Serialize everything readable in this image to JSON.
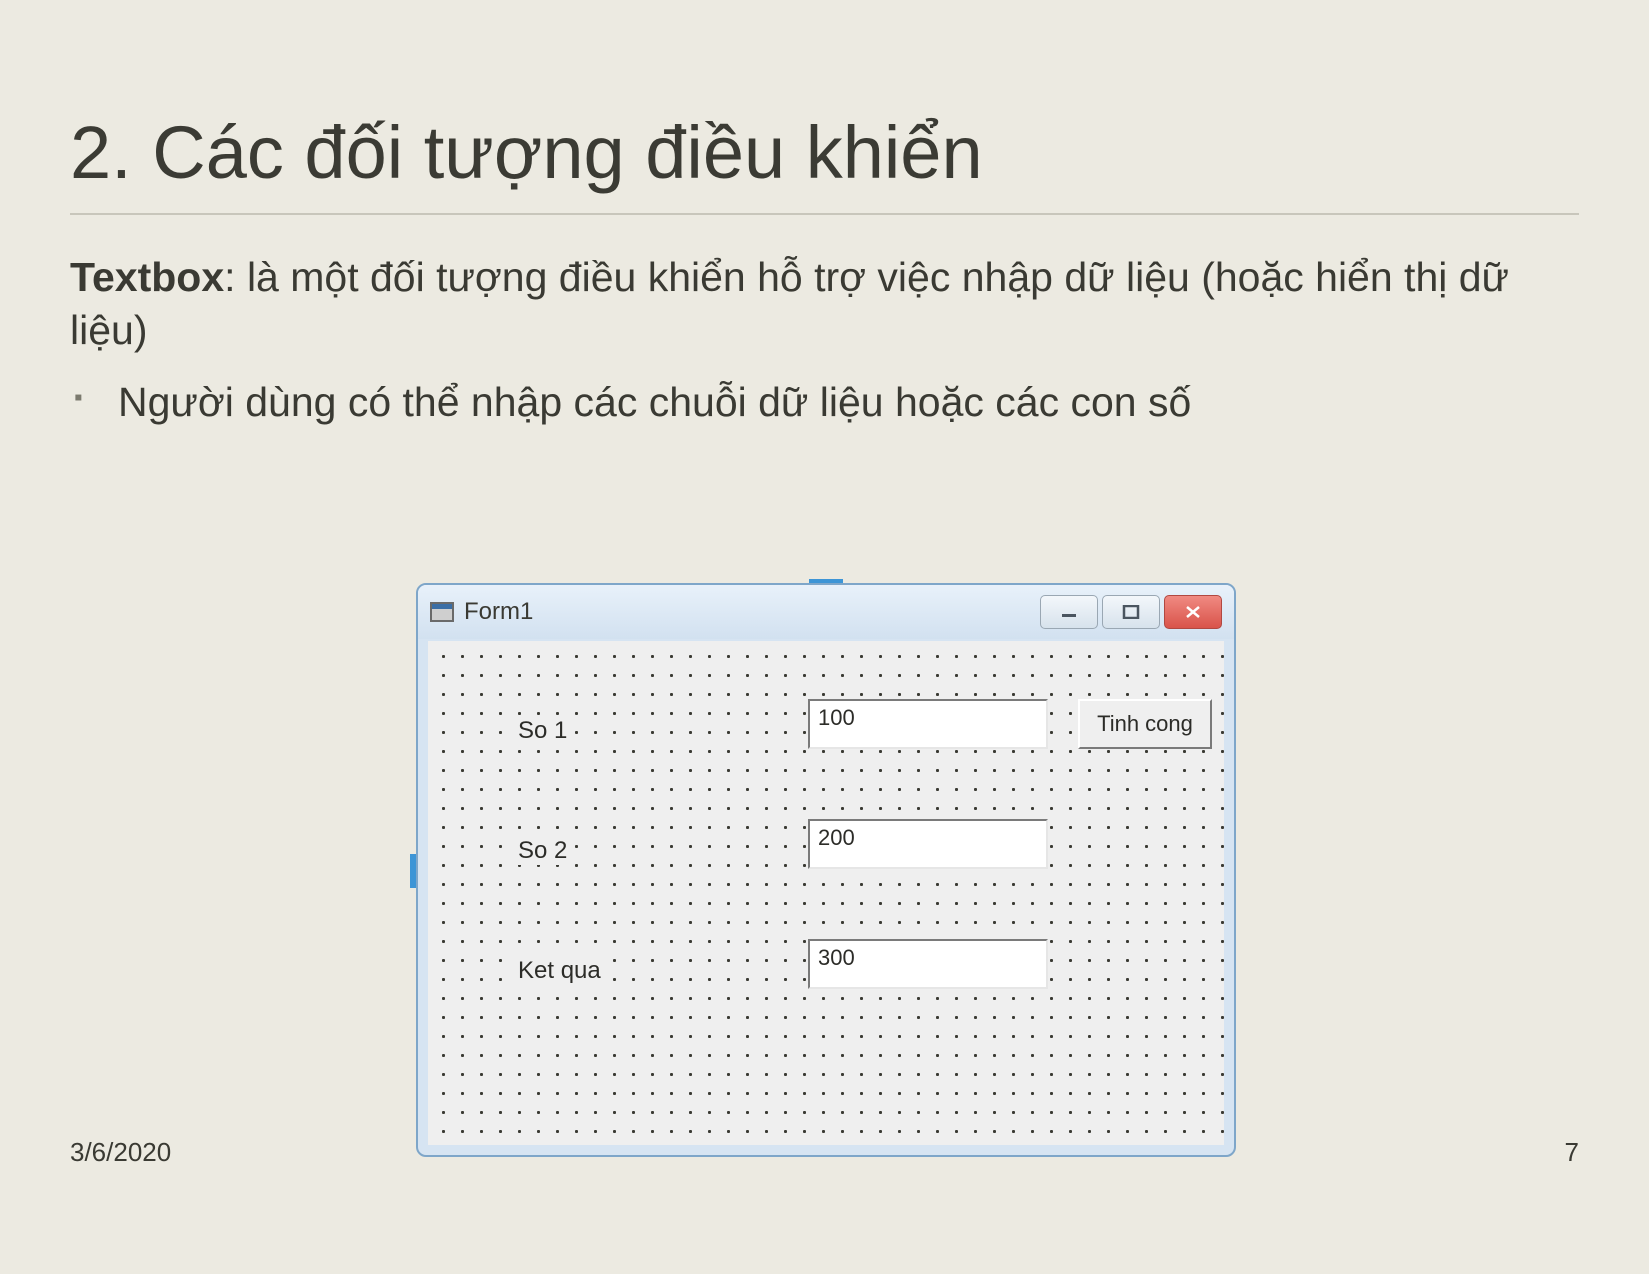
{
  "slide": {
    "title": "2. Các đối tượng điều khiển",
    "intro_bold": "Textbox",
    "intro_rest": ": là một đối tượng điều khiển hỗ trợ việc nhập dữ liệu (hoặc hiển thị dữ liệu)",
    "bullet1": "Người dùng có thể nhập các chuỗi dữ liệu hoặc các con số",
    "footer_date": "3/6/2020",
    "footer_page": "7"
  },
  "form": {
    "title": "Form1",
    "labels": {
      "so1": "So 1",
      "so2": "So 2",
      "ketqua": "Ket qua"
    },
    "values": {
      "so1": "100",
      "so2": "200",
      "ketqua": "300"
    },
    "button": "Tinh cong"
  }
}
